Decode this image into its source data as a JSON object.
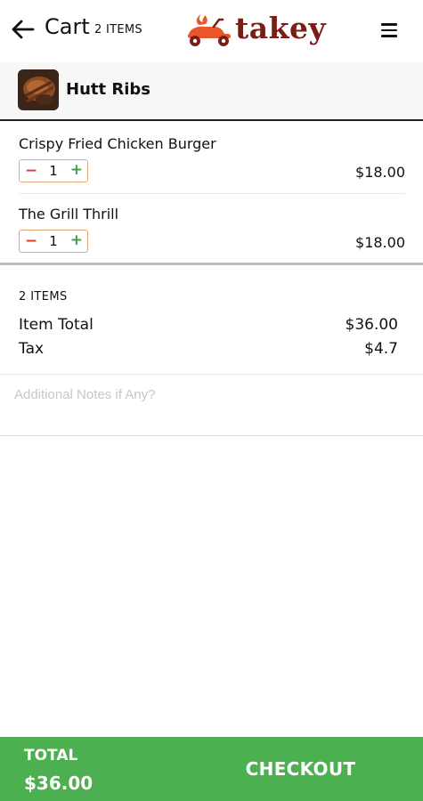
{
  "header": {
    "title": "Cart",
    "item_count": "2 ITEMS",
    "logo_text": "takey"
  },
  "restaurant": {
    "name": "Hutt Ribs"
  },
  "items": [
    {
      "name": "Crispy Fried Chicken Burger",
      "quantity": "1",
      "price": "$18.00",
      "minus": "−",
      "plus": "+"
    },
    {
      "name": "The Grill Thrill",
      "quantity": "1",
      "price": "$18.00",
      "minus": "−",
      "plus": "+"
    }
  ],
  "summary": {
    "item_count": "2 ITEMS",
    "item_total_label": "Item Total",
    "item_total_value": "$36.00",
    "tax_label": "Tax",
    "tax_value": "$4.7"
  },
  "notes": {
    "placeholder": "Additional Notes if Any?"
  },
  "footer": {
    "total_label": "TOTAL",
    "total_value": "$36.00",
    "checkout_label": "CHECKOUT"
  },
  "colors": {
    "footer_green": "#4caf50",
    "logo_brown": "#7a1e14",
    "minus_red": "#e53935",
    "plus_green": "#43a047",
    "qty_border": "#e3a676"
  },
  "icons": {
    "back": "arrow-left-icon",
    "menu": "hamburger-menu-icon",
    "logo": "scooter-logo-icon"
  }
}
